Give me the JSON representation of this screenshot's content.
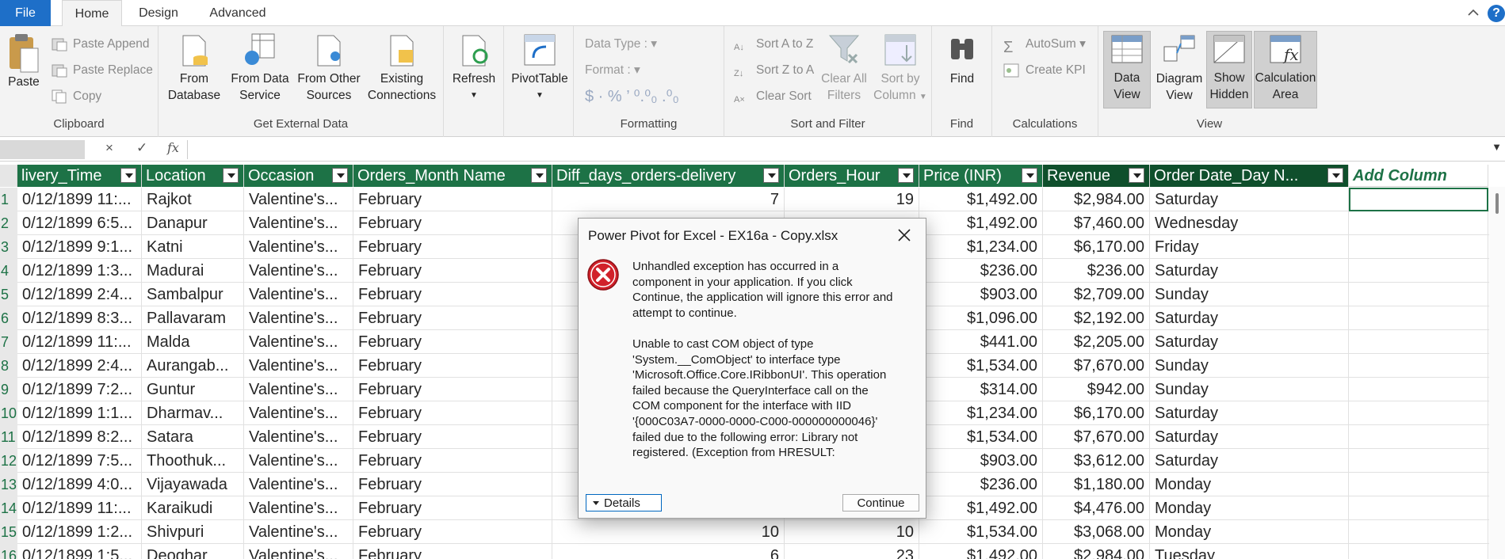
{
  "tabs": {
    "file": "File",
    "home": "Home",
    "design": "Design",
    "advanced": "Advanced",
    "help": "?"
  },
  "ribbon": {
    "clipboard": {
      "label": "Clipboard",
      "paste": "Paste",
      "paste_append": "Paste Append",
      "paste_replace": "Paste Replace",
      "copy": "Copy"
    },
    "external": {
      "label": "Get External Data",
      "from_database_1": "From",
      "from_database_2": "Database",
      "from_data_service_1": "From Data",
      "from_data_service_2": "Service",
      "from_other_1": "From Other",
      "from_other_2": "Sources",
      "existing_1": "Existing",
      "existing_2": "Connections"
    },
    "refresh": {
      "label": "Refresh"
    },
    "pivottable": {
      "label": "PivotTable"
    },
    "formatting": {
      "label": "Formatting",
      "data_type": "Data Type :",
      "format": "Format :",
      "symbols": "$ · %  ’  ⁰.⁰₀  .⁰₀"
    },
    "sortfilter": {
      "label": "Sort and Filter",
      "sort_az": "Sort A to Z",
      "sort_za": "Sort Z to A",
      "clear_sort": "Clear Sort",
      "clear_all_1": "Clear All",
      "clear_all_2": "Filters",
      "sort_by_1": "Sort by",
      "sort_by_2": "Column"
    },
    "find": {
      "label": "Find",
      "button": "Find"
    },
    "calculations": {
      "label": "Calculations",
      "autosum": "AutoSum",
      "create_kpi": "Create KPI"
    },
    "view": {
      "label": "View",
      "data_view_1": "Data",
      "data_view_2": "View",
      "diagram_1": "Diagram",
      "diagram_2": "View",
      "show_hidden_1": "Show",
      "show_hidden_2": "Hidden",
      "calc_area_1": "Calculation",
      "calc_area_2": "Area"
    }
  },
  "formula_bar": {
    "cancel": "×",
    "enter": "✓",
    "fx": "fx",
    "value": ""
  },
  "columns": [
    "livery_Time",
    "Location",
    "Occasion",
    "Orders_Month Name",
    "Diff_days_orders-delivery",
    "Orders_Hour",
    "Price (INR)",
    "Revenue",
    "Order Date_Day N...",
    "Add Column"
  ],
  "rows": [
    {
      "n": "1",
      "time": "0/12/1899 11:...",
      "loc": "Rajkot",
      "occ": "Valentine's...",
      "month": "February",
      "diff": "7",
      "hour": "19",
      "price": "$1,492.00",
      "rev": "$2,984.00",
      "day": "Saturday"
    },
    {
      "n": "2",
      "time": "0/12/1899 6:5...",
      "loc": "Danapur",
      "occ": "Valentine's...",
      "month": "February",
      "diff": "",
      "hour": "",
      "price": "$1,492.00",
      "rev": "$7,460.00",
      "day": "Wednesday"
    },
    {
      "n": "3",
      "time": "0/12/1899 9:1...",
      "loc": "Katni",
      "occ": "Valentine's...",
      "month": "February",
      "diff": "",
      "hour": "",
      "price": "$1,234.00",
      "rev": "$6,170.00",
      "day": "Friday"
    },
    {
      "n": "4",
      "time": "0/12/1899 1:3...",
      "loc": "Madurai",
      "occ": "Valentine's...",
      "month": "February",
      "diff": "",
      "hour": "",
      "price": "$236.00",
      "rev": "$236.00",
      "day": "Saturday"
    },
    {
      "n": "5",
      "time": "0/12/1899 2:4...",
      "loc": "Sambalpur",
      "occ": "Valentine's...",
      "month": "February",
      "diff": "",
      "hour": "",
      "price": "$903.00",
      "rev": "$2,709.00",
      "day": "Sunday"
    },
    {
      "n": "6",
      "time": "0/12/1899 8:3...",
      "loc": "Pallavaram",
      "occ": "Valentine's...",
      "month": "February",
      "diff": "",
      "hour": "",
      "price": "$1,096.00",
      "rev": "$2,192.00",
      "day": "Saturday"
    },
    {
      "n": "7",
      "time": "0/12/1899 11:...",
      "loc": "Malda",
      "occ": "Valentine's...",
      "month": "February",
      "diff": "",
      "hour": "",
      "price": "$441.00",
      "rev": "$2,205.00",
      "day": "Saturday"
    },
    {
      "n": "8",
      "time": "0/12/1899 2:4...",
      "loc": "Aurangab...",
      "occ": "Valentine's...",
      "month": "February",
      "diff": "",
      "hour": "",
      "price": "$1,534.00",
      "rev": "$7,670.00",
      "day": "Sunday"
    },
    {
      "n": "9",
      "time": "0/12/1899 7:2...",
      "loc": "Guntur",
      "occ": "Valentine's...",
      "month": "February",
      "diff": "",
      "hour": "",
      "price": "$314.00",
      "rev": "$942.00",
      "day": "Sunday"
    },
    {
      "n": "10",
      "time": "0/12/1899 1:1...",
      "loc": "Dharmav...",
      "occ": "Valentine's...",
      "month": "February",
      "diff": "",
      "hour": "",
      "price": "$1,234.00",
      "rev": "$6,170.00",
      "day": "Saturday"
    },
    {
      "n": "11",
      "time": "0/12/1899 8:2...",
      "loc": "Satara",
      "occ": "Valentine's...",
      "month": "February",
      "diff": "",
      "hour": "",
      "price": "$1,534.00",
      "rev": "$7,670.00",
      "day": "Saturday"
    },
    {
      "n": "12",
      "time": "0/12/1899 7:5...",
      "loc": "Thoothuk...",
      "occ": "Valentine's...",
      "month": "February",
      "diff": "",
      "hour": "",
      "price": "$903.00",
      "rev": "$3,612.00",
      "day": "Saturday"
    },
    {
      "n": "13",
      "time": "0/12/1899 4:0...",
      "loc": "Vijayawada",
      "occ": "Valentine's...",
      "month": "February",
      "diff": "",
      "hour": "",
      "price": "$236.00",
      "rev": "$1,180.00",
      "day": "Monday"
    },
    {
      "n": "14",
      "time": "0/12/1899 11:...",
      "loc": "Karaikudi",
      "occ": "Valentine's...",
      "month": "February",
      "diff": "",
      "hour": "",
      "price": "$1,492.00",
      "rev": "$4,476.00",
      "day": "Monday"
    },
    {
      "n": "15",
      "time": "0/12/1899 1:2...",
      "loc": "Shivpuri",
      "occ": "Valentine's...",
      "month": "February",
      "diff": "10",
      "hour": "10",
      "price": "$1,534.00",
      "rev": "$3,068.00",
      "day": "Monday"
    },
    {
      "n": "16",
      "time": "0/12/1899 1:5...",
      "loc": "Deoghar",
      "occ": "Valentine's...",
      "month": "February",
      "diff": "6",
      "hour": "23",
      "price": "$1,492.00",
      "rev": "$2,984.00",
      "day": "Tuesday"
    }
  ],
  "dialog": {
    "title": "Power Pivot for Excel - EX16a - Copy.xlsx",
    "message": "Unhandled exception has occurred in a\ncomponent in your application. If you click\nContinue, the application will ignore this error and\nattempt to continue.\n\nUnable to cast COM object of type\n'System.__ComObject' to interface type\n'Microsoft.Office.Core.IRibbonUI'. This operation\nfailed because the QueryInterface call on the\nCOM component for the interface with IID\n'{000C03A7-0000-0000-C000-000000000046}'\nfailed due to the following error: Library not\nregistered. (Exception from HRESULT:",
    "details": "Details",
    "continue": "Continue"
  },
  "colors": {
    "header_green": "#1d7246",
    "file_blue": "#1e6fc8",
    "error_red": "#d1212a"
  }
}
